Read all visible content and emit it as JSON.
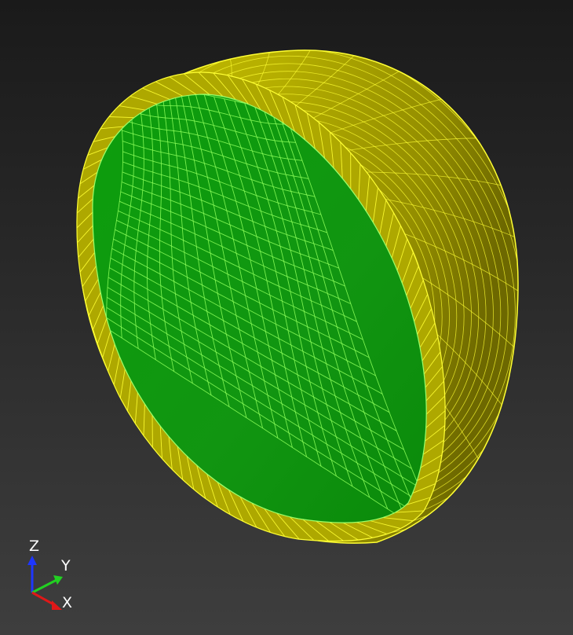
{
  "colors": {
    "background_top": "#1a1a1a",
    "background_bottom": "#3e3e3e",
    "shell_face": "#b9b300",
    "shell_shadow": "#6f6a00",
    "shell_rim": "#c8c000",
    "mesh_yellow": "#ffff33",
    "cut_face": "#0f9a0f",
    "mesh_green": "#8cff5a"
  },
  "mesh": {
    "cut_face_rows": 24,
    "cut_face_cols": 20,
    "shell_meridians": 12,
    "shell_parallels": 22
  },
  "triad": {
    "z_label": "Z",
    "y_label": "Y",
    "x_label": "X",
    "z_color": "#1e36ff",
    "y_color": "#22d022",
    "x_color": "#e01818"
  }
}
